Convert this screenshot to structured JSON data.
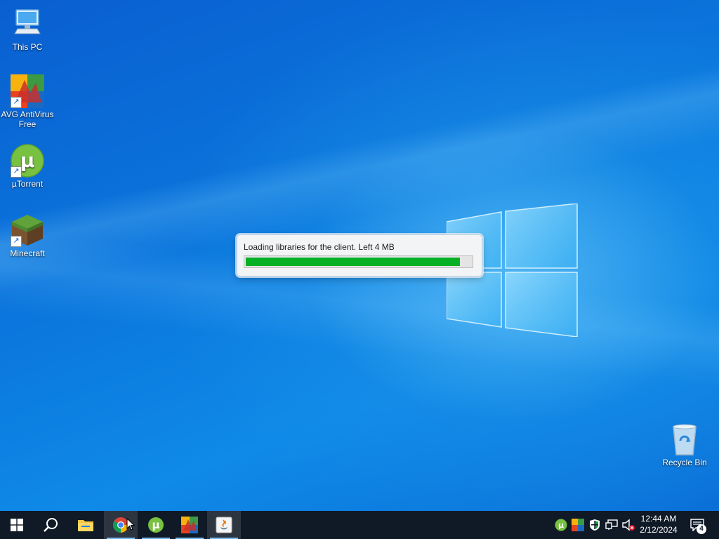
{
  "desktop": {
    "icons": [
      {
        "label": "This PC"
      },
      {
        "label": "AVG AntiVirus Free"
      },
      {
        "label": "µTorrent"
      },
      {
        "label": "Minecraft"
      },
      {
        "label": "Recycle Bin"
      }
    ]
  },
  "loader": {
    "message": "Loading libraries for the client. Left 4 MB",
    "progress": 0.95,
    "fill_color": "#06b025"
  },
  "taskbar": {
    "pinned": [
      {
        "icon": "windows-start-icon"
      },
      {
        "icon": "search-icon"
      },
      {
        "icon": "file-explorer-icon"
      },
      {
        "icon": "chrome-icon"
      },
      {
        "icon": "utorrent-icon"
      },
      {
        "icon": "avg-icon"
      },
      {
        "icon": "java-icon"
      }
    ],
    "tray": {
      "icons": [
        "utorrent-tray-icon",
        "avg-tray-icon",
        "security-shield-icon",
        "network-icon",
        "volume-muted-icon"
      ],
      "time": "12:44 AM",
      "date": "2/12/2024",
      "notification_count": "4"
    },
    "accent": "#76b9ed"
  }
}
